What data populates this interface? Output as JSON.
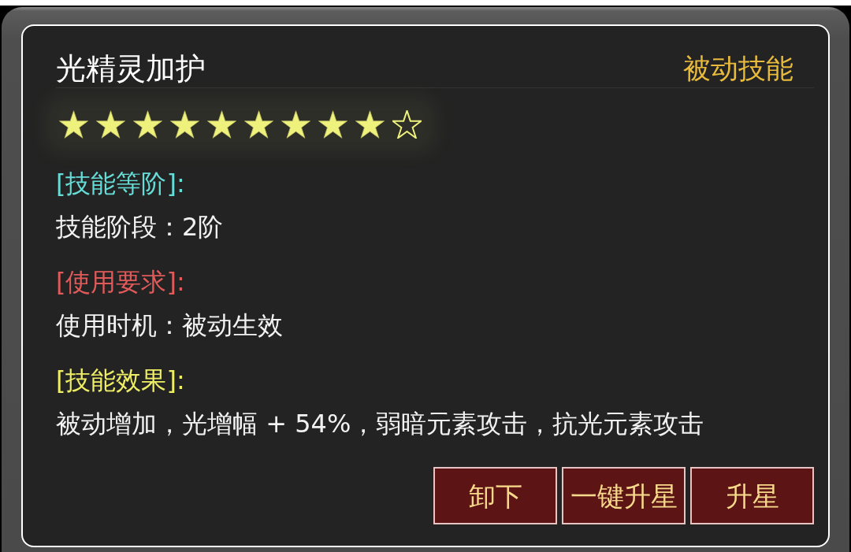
{
  "dialog": {
    "title": "光精灵加护",
    "category": "被动技能",
    "stars": 9,
    "sections": [
      {
        "heading": "[技能等阶]:",
        "color": "#66dcd6",
        "text": "技能阶段：2阶"
      },
      {
        "heading": "[使用要求]:",
        "color": "#e05a5a",
        "text": "使用时机：被动生效"
      },
      {
        "heading": "[技能效果]:",
        "color": "#eeee66",
        "text": "被动增加，光增幅 + 54%，弱暗元素攻击，抗光元素攻击"
      }
    ],
    "buttons": [
      {
        "label": "卸下"
      },
      {
        "label": "一键升星"
      },
      {
        "label": "升星"
      }
    ]
  }
}
